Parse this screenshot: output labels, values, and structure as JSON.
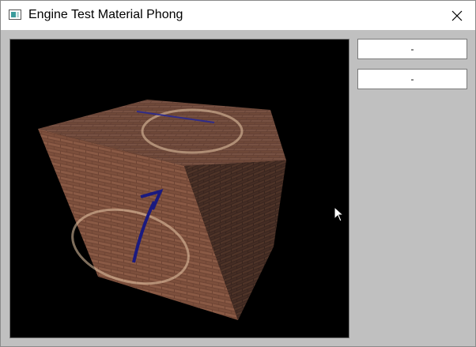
{
  "window": {
    "title": "Engine Test Material Phong",
    "icon": "app-window-icon",
    "close_icon": "close-icon"
  },
  "side_panel": {
    "buttons": [
      {
        "label": "-"
      },
      {
        "label": "-"
      }
    ]
  },
  "viewport": {
    "content": "textured-cube-render",
    "background_color": "#000000",
    "texture": "brick",
    "arrow_color": "#1a1a80"
  },
  "colors": {
    "client_background": "#c0c0c0",
    "titlebar_background": "#ffffff"
  }
}
